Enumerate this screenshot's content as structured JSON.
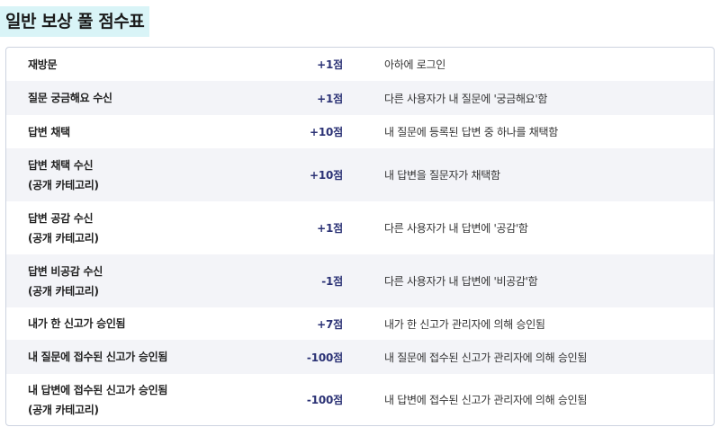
{
  "title": "일반 보상 풀 점수표",
  "rows": [
    {
      "name_line1": "재방문",
      "name_line2": "",
      "points": "+1점",
      "description": "아하에 로그인"
    },
    {
      "name_line1": "질문 궁금해요 수신",
      "name_line2": "",
      "points": "+1점",
      "description": "다른 사용자가 내 질문에 '궁금해요'함"
    },
    {
      "name_line1": "답변 채택",
      "name_line2": "",
      "points": "+10점",
      "description": "내 질문에 등록된 답변 중 하나를 채택함"
    },
    {
      "name_line1": "답변 채택 수신",
      "name_line2": "(공개 카테고리)",
      "points": "+10점",
      "description": "내 답변을 질문자가 채택함"
    },
    {
      "name_line1": "답변 공감 수신",
      "name_line2": "(공개 카테고리)",
      "points": "+1점",
      "description": "다른 사용자가 내 답변에 '공감'함"
    },
    {
      "name_line1": "답변 비공감 수신",
      "name_line2": "(공개 카테고리)",
      "points": "-1점",
      "description": "다른 사용자가 내 답변에 '비공감'함"
    },
    {
      "name_line1": "내가 한 신고가 승인됨",
      "name_line2": "",
      "points": "+7점",
      "description": "내가 한 신고가 관리자에 의해 승인됨"
    },
    {
      "name_line1": "내 질문에 접수된 신고가 승인됨",
      "name_line2": "",
      "points": "-100점",
      "description": "내 질문에 접수된 신고가 관리자에 의해 승인됨"
    },
    {
      "name_line1": "내 답변에 접수된 신고가 승인됨",
      "name_line2": "(공개 카테고리)",
      "points": "-100점",
      "description": "내 답변에 접수된 신고가 관리자에 의해 승인됨"
    }
  ]
}
